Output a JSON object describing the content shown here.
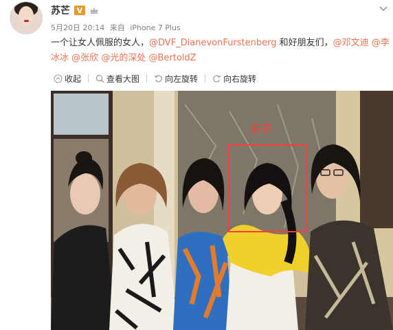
{
  "post": {
    "username": "苏芒",
    "vip_label": "V",
    "meta": {
      "date": "5月20日 20:14",
      "source_prefix": "来自",
      "device": "iPhone 7 Plus"
    },
    "text_segments": [
      {
        "text": "一个让女人佩服的女人，",
        "mention": false
      },
      {
        "text": "@DVF_DianevonFurstenberg",
        "mention": true
      },
      {
        "text": " 和好朋友们，",
        "mention": false
      },
      {
        "text": "@邓文迪",
        "mention": true
      },
      {
        "text": " ",
        "mention": false
      },
      {
        "text": "@李冰冰",
        "mention": true
      },
      {
        "text": " ",
        "mention": false
      },
      {
        "text": "@张欣",
        "mention": true
      },
      {
        "text": " ",
        "mention": false
      },
      {
        "text": "@光的深处",
        "mention": true
      },
      {
        "text": " ",
        "mention": false
      },
      {
        "text": "@BertoldZ",
        "mention": true
      }
    ],
    "toolbar": {
      "collapse": "收起",
      "view_large": "查看大图",
      "rotate_left": "向左旋转",
      "rotate_right": "向右旋转"
    },
    "photo": {
      "annotation": "苏芒",
      "annotation_color": "#ff3c3c"
    }
  },
  "colors": {
    "mention": "#eb7350",
    "meta": "#808080",
    "vip": "#e89a2c"
  }
}
